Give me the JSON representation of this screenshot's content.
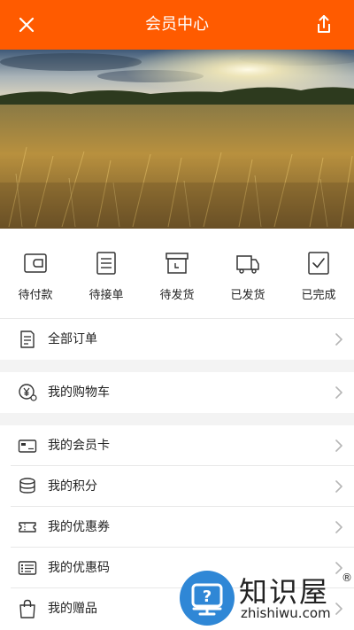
{
  "header": {
    "title": "会员中心"
  },
  "orders": [
    {
      "label": "待付款",
      "icon": "wallet-icon"
    },
    {
      "label": "待接单",
      "icon": "list-icon"
    },
    {
      "label": "待发货",
      "icon": "box-icon"
    },
    {
      "label": "已发货",
      "icon": "truck-icon"
    },
    {
      "label": "已完成",
      "icon": "check-icon"
    }
  ],
  "menu": {
    "all_orders": "全部订单",
    "cart": "我的购物车",
    "member_card": "我的会员卡",
    "points": "我的积分",
    "coupons": "我的优惠券",
    "promo_code": "我的优惠码",
    "gifts": "我的赠品"
  },
  "watermark": {
    "name": "知识屋",
    "url": "zhishiwu.com",
    "reg": "®"
  },
  "colors": {
    "header": "#ff5b00",
    "separator": "#f3f3f3"
  }
}
